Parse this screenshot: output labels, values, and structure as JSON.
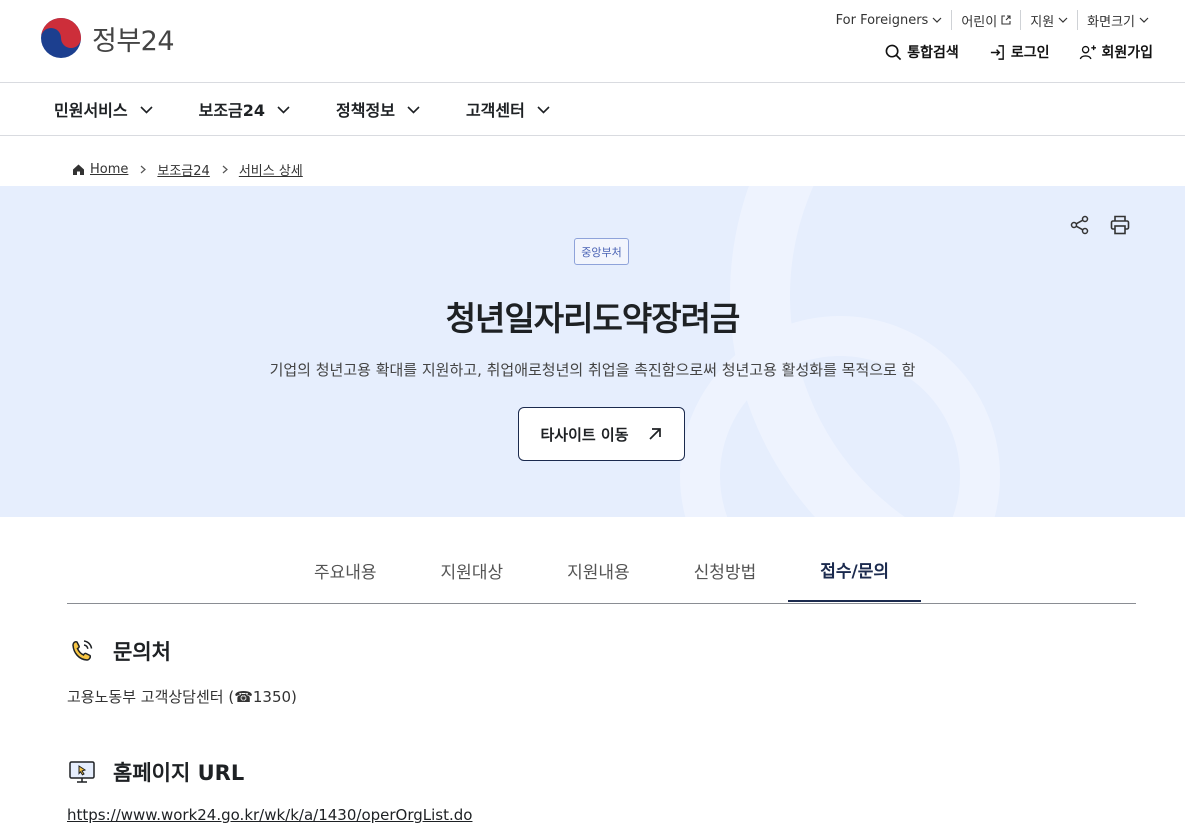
{
  "header": {
    "logo_text": "정부24",
    "util": [
      {
        "label": "For Foreigners",
        "icon": "chevron-down-icon"
      },
      {
        "label": "어린이",
        "icon": "external-link-icon"
      },
      {
        "label": "지원",
        "icon": "chevron-down-icon"
      },
      {
        "label": "화면크기",
        "icon": "chevron-down-icon"
      }
    ],
    "account": {
      "search": "통합검색",
      "login": "로그인",
      "signup": "회원가입"
    }
  },
  "gnb": [
    "민원서비스",
    "보조금24",
    "정책정보",
    "고객센터"
  ],
  "breadcrumb": [
    "Home",
    "보조금24",
    "서비스 상세"
  ],
  "hero": {
    "badge": "중앙부처",
    "title": "청년일자리도약장려금",
    "description": "기업의 청년고용 확대를 지원하고, 취업애로청년의 취업을 촉진함으로써 청년고용 활성화를 목적으로 함",
    "site_button": "타사이트 이동",
    "colors": {
      "background": "#e6eefd",
      "accent": "#1b2a4e"
    }
  },
  "tabs": [
    {
      "label": "주요내용",
      "active": false
    },
    {
      "label": "지원대상",
      "active": false
    },
    {
      "label": "지원내용",
      "active": false
    },
    {
      "label": "신청방법",
      "active": false
    },
    {
      "label": "접수/문의",
      "active": true
    }
  ],
  "contact": {
    "title": "문의처",
    "body": "고용노동부 고객상담센터 (☎1350)"
  },
  "homepage": {
    "title": "홈페이지 URL",
    "url": "https://www.work24.go.kr/wk/k/a/1430/operOrgList.do"
  }
}
